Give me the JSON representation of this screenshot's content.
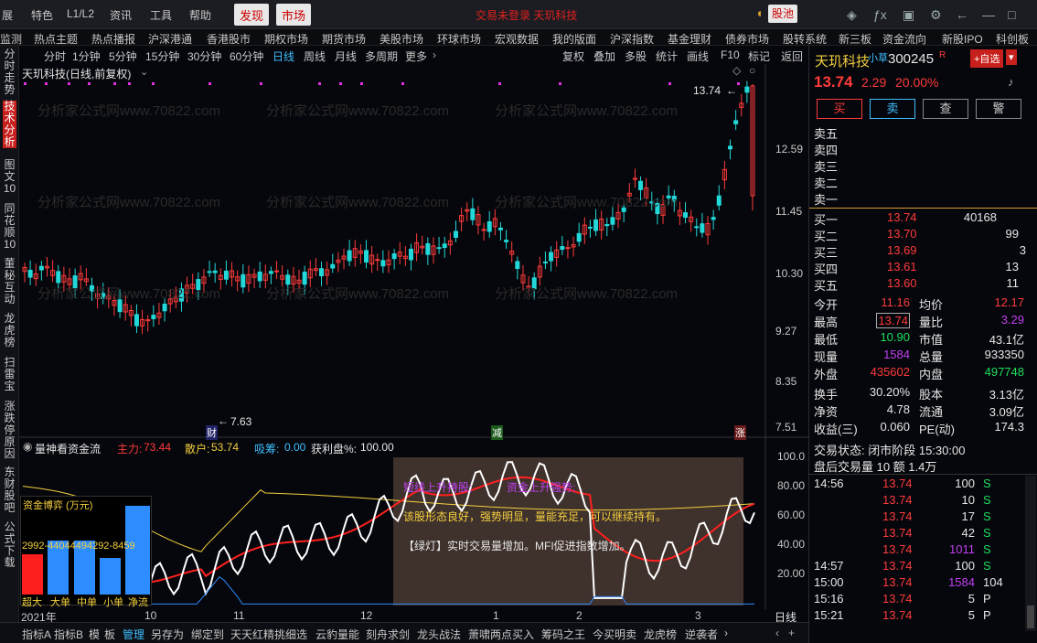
{
  "top": {
    "menu": [
      "展",
      "特色",
      "L1/L2",
      "资讯",
      "工具",
      "帮助"
    ],
    "btn_discover": "发现",
    "btn_market": "市场",
    "center_title": "交易未登录  天玑科技",
    "stockpool": "股池"
  },
  "nav": [
    "监测",
    "热点主题",
    "热点播报",
    "沪深港通",
    "香港股市",
    "期权市场",
    "期货市场",
    "美股市场",
    "环球市场",
    "宏观数据",
    "我的版面",
    "沪深指数",
    "基金理财",
    "债券市场",
    "股转系统",
    "新三板",
    "资金流向",
    "新股IPO",
    "科创板"
  ],
  "left_tabs": [
    "分时走势",
    "技术分析",
    "图文10",
    "同花顺10",
    "董秘互动",
    "龙虎榜",
    "扫雷宝",
    "涨跌停原因",
    "东财股吧",
    "公式下载"
  ],
  "timeframes": [
    "分时",
    "1分钟",
    "5分钟",
    "15分钟",
    "30分钟",
    "60分钟",
    "日线",
    "周线",
    "月线",
    "多周期",
    "更多"
  ],
  "tools": [
    "复权",
    "叠加",
    "多股",
    "统计",
    "画线",
    "F10",
    "标记",
    "返回"
  ],
  "chart": {
    "title": "天玑科技(日线,前复权)",
    "y_ticks": [
      "12.59",
      "11.45",
      "10.30",
      "9.27",
      "8.35",
      "7.51"
    ],
    "high_label": "13.74",
    "low_label": "7.63",
    "mark_cai": "财",
    "mark_jian": "减",
    "mark_zhang": "涨"
  },
  "indicator": {
    "name": "量神看资金流",
    "main_label": "主力:",
    "main_val": "73.44",
    "retail_label": "散户:",
    "retail_val": "53.74",
    "chip_label": "吸筹:",
    "chip_val": "0.00",
    "profit_label": "获利盘%:",
    "profit_val": "100.00",
    "y_ticks": [
      "100.0",
      "80.00",
      "60.00",
      "40.00",
      "20.00"
    ],
    "txt1": "短线上升持股;",
    "txt2": "资金上升强势;",
    "txt3": "该股形态良好，强势明显，量能充足，可以继续持有。",
    "txt4": "【绿灯】实时交易量增加。MFI促进指数增加。"
  },
  "fund_box": {
    "title": "资金博弈 (万元)",
    "values": "2992-44044494292-8459",
    "labels": [
      "超大",
      "大单",
      "中单",
      "小单",
      "净流"
    ]
  },
  "x_axis": [
    "2021年",
    "10",
    "11",
    "12",
    "1",
    "2",
    "3"
  ],
  "x_scale_label": "日线",
  "bottom_tabs": [
    "指标A",
    "指标B",
    "模",
    "板",
    "管理",
    "另存为",
    "绑定到",
    "天天红精挑细选",
    "云豹量能",
    "刻舟求剑",
    "龙头战法",
    "萧啸两点买入",
    "筹码之王",
    "今买明卖",
    "龙虎榜",
    "逆袭者"
  ],
  "quote": {
    "name": "天玑科技",
    "tag": "小草",
    "code": "300245",
    "r": "R",
    "add_btn": "+自选",
    "price": "13.74",
    "change": "2.29",
    "pct": "20.00%",
    "buy": "买",
    "sell": "卖",
    "query": "查",
    "alert": "警",
    "asks": [
      {
        "l": "卖五",
        "p": "",
        "v": ""
      },
      {
        "l": "卖四",
        "p": "",
        "v": ""
      },
      {
        "l": "卖三",
        "p": "",
        "v": ""
      },
      {
        "l": "卖二",
        "p": "",
        "v": ""
      },
      {
        "l": "卖一",
        "p": "",
        "v": ""
      }
    ],
    "bids": [
      {
        "l": "买一",
        "p": "13.74",
        "v": "40168"
      },
      {
        "l": "买二",
        "p": "13.70",
        "v": "99"
      },
      {
        "l": "买三",
        "p": "13.69",
        "v": "3"
      },
      {
        "l": "买四",
        "p": "13.61",
        "v": "13"
      },
      {
        "l": "买五",
        "p": "13.60",
        "v": "11"
      }
    ],
    "stats": [
      [
        "今开",
        "11.16",
        "均价",
        "12.17"
      ],
      [
        "最高",
        "13.74",
        "量比",
        "3.29"
      ],
      [
        "最低",
        "10.90",
        "市值",
        "43.1亿"
      ],
      [
        "现量",
        "1584",
        "总量",
        "933350"
      ],
      [
        "外盘",
        "435602",
        "内盘",
        "497748"
      ],
      [
        "换手",
        "30.20%",
        "股本",
        "3.13亿"
      ],
      [
        "净资",
        "4.78",
        "流通",
        "3.09亿"
      ],
      [
        "收益(三)",
        "0.060",
        "PE(动)",
        "174.3"
      ]
    ],
    "status": "交易状态: 闭市阶段 15:30:00",
    "after": "盘后交易量 10 额 1.4万",
    "ticks": [
      [
        "14:56",
        "13.74",
        "100",
        "S"
      ],
      [
        "",
        "13.74",
        "10",
        "S"
      ],
      [
        "",
        "13.74",
        "17",
        "S"
      ],
      [
        "",
        "13.74",
        "42",
        "S"
      ],
      [
        "",
        "13.74",
        "1011",
        "S"
      ],
      [
        "14:57",
        "13.74",
        "100",
        "S"
      ],
      [
        "15:00",
        "13.74",
        "1584",
        "104"
      ],
      [
        "15:16",
        "13.74",
        "5",
        "P"
      ],
      [
        "15:21",
        "13.74",
        "5",
        "P"
      ]
    ]
  },
  "colors": {
    "up": "#ff3b3b",
    "down": "#22d8d8",
    "bg": "#06070c",
    "accent": "#3fbfff"
  }
}
